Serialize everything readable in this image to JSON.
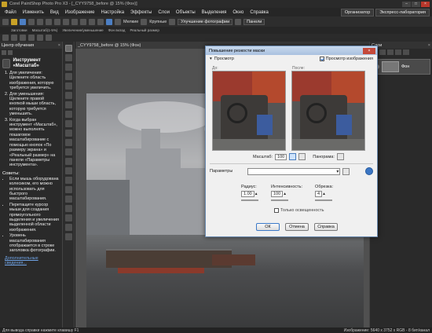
{
  "app": {
    "title": "Corel PaintShop Photo Pro X3 - [_CYY9758_before @ 15% (Фон)]"
  },
  "menubar": {
    "items": [
      "Файл",
      "Изменить",
      "Вид",
      "Изображение",
      "Настройка",
      "Эффекты",
      "Слои",
      "Объекты",
      "Выделения",
      "Окно",
      "Справка"
    ],
    "right_buttons": [
      "Организатор",
      "Экспресс-лаборатория"
    ]
  },
  "toolbar": {
    "small_label": "Мелкие",
    "large_label": "Крупные",
    "enhance_label": "Улучшение фотографии",
    "panels_label": "Панели"
  },
  "toolbar2": {
    "labels": [
      "Заготовки",
      "Масштаб(1-5%)",
      "Увеличение/уменьшение",
      "Фон вклад",
      "Реальный размер"
    ]
  },
  "learning": {
    "panel_title": "Центр обучения",
    "heading": "Инструмент «Масштаб»",
    "steps": [
      "Для увеличения: Щелкните область изображения, которую требуется увеличить.",
      "Для уменьшения: Щелкните правой кнопкой мыши область, которую требуется уменьшить.",
      "Когда выбран инструмент «Масштаб», можно выполнять пошаговое масштабирование с помощью кнопок «По размеру экрана» и «Реальный размер» на панели «Параметры инструмента»."
    ],
    "tips_title": "Советы:",
    "tips": [
      "Если мышь оборудована колесиком, его можно использовать для быстрого масштабирования.",
      "Перетащите курсор мыши для создания прямоугольного выделения и увеличения выделенной области изображения.",
      "Уровень масштабирования отображается в строке заголовка фотографии."
    ],
    "more_link": "Дополнительные сведения..."
  },
  "document": {
    "tab_title": "_CYY9758_before @ 15% (Фон)"
  },
  "layers": {
    "panel_title": "Слои",
    "layer_name": "Фон"
  },
  "dialog": {
    "title": "Повышение резкости маски",
    "preview_label": "Просмотр",
    "preview_image_label": "Просмотр изображения",
    "before_label": "До:",
    "after_label": "После:",
    "zoom_label": "Масштаб:",
    "zoom_value": "100",
    "pan_label": "Панорама:",
    "presets_label": "Параметры",
    "radius_label": "Радиус:",
    "radius_value": "1.00",
    "strength_label": "Интенсивность:",
    "strength_value": "100",
    "clipping_label": "Обрезка:",
    "clipping_value": "4",
    "luminance_label": "Только освещенность",
    "ok_label": "ОК",
    "cancel_label": "Отмена",
    "help_label": "Справка"
  },
  "status": {
    "left": "Для вывода справки нажмите клавишу F1",
    "right": "Изображение: 5640 x 3752 x RGB - 8 бит/канал"
  }
}
